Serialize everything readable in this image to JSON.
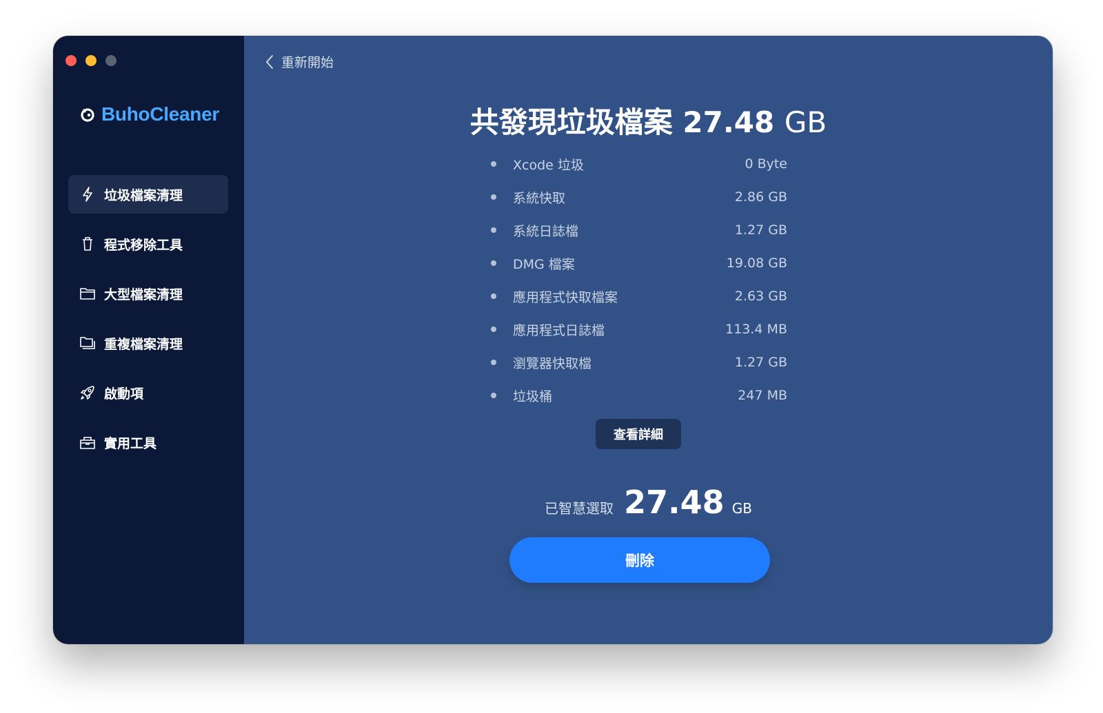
{
  "app": {
    "name": "BuhoCleaner",
    "brand_color": "#4aa8ff"
  },
  "sidebar": {
    "items": [
      {
        "label": "垃圾檔案清理",
        "icon": "lightning-icon",
        "active": true
      },
      {
        "label": "程式移除工具",
        "icon": "trash-icon",
        "active": false
      },
      {
        "label": "大型檔案清理",
        "icon": "folder-icon",
        "active": false
      },
      {
        "label": "重複檔案清理",
        "icon": "duplicate-folder-icon",
        "active": false
      },
      {
        "label": "啟動項",
        "icon": "rocket-icon",
        "active": false
      },
      {
        "label": "實用工具",
        "icon": "toolbox-icon",
        "active": false
      }
    ]
  },
  "header": {
    "back_label": "重新開始"
  },
  "summary": {
    "title_prefix": "共發現垃圾檔案",
    "total_number": "27.48",
    "total_unit": "GB"
  },
  "junk_list": [
    {
      "label": "Xcode 垃圾",
      "size": "0 Byte"
    },
    {
      "label": "系統快取",
      "size": "2.86 GB"
    },
    {
      "label": "系統日誌檔",
      "size": "1.27 GB"
    },
    {
      "label": "DMG 檔案",
      "size": "19.08 GB"
    },
    {
      "label": "應用程式快取檔案",
      "size": "2.63 GB"
    },
    {
      "label": "應用程式日誌檔",
      "size": "113.4 MB"
    },
    {
      "label": "瀏覽器快取檔",
      "size": "1.27 GB"
    },
    {
      "label": "垃圾桶",
      "size": "247 MB"
    }
  ],
  "details_button": "查看詳細",
  "selection": {
    "label": "已智慧選取",
    "number": "27.48",
    "unit": "GB"
  },
  "delete_button": "刪除",
  "colors": {
    "sidebar_bg": "#0b1838",
    "main_bg": "#325287",
    "primary_button": "#1f7cff"
  }
}
